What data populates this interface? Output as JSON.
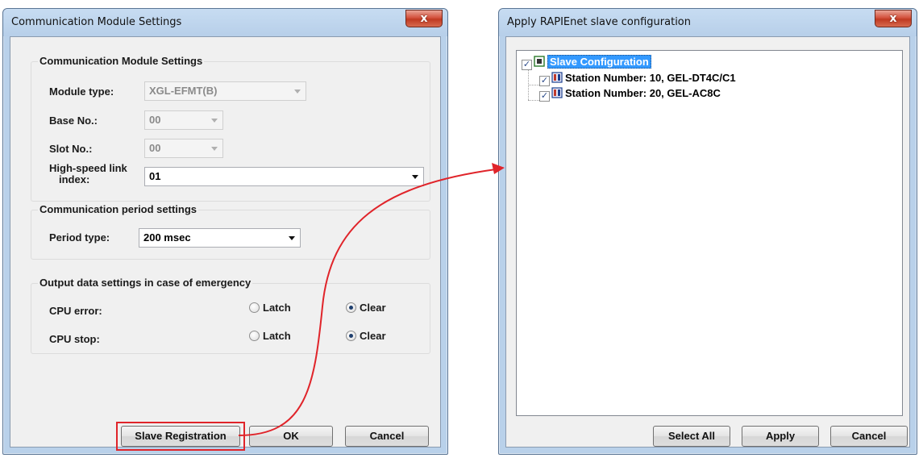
{
  "left_dialog": {
    "title": "Communication Module Settings",
    "close": "x",
    "module_group": {
      "title": "Communication Module Settings",
      "module_type_label": "Module type:",
      "module_type_value": "XGL-EFMT(B)",
      "base_label": "Base No.:",
      "base_value": "00",
      "slot_label": "Slot No.:",
      "slot_value": "00",
      "hs_link_label_1": "High-speed link",
      "hs_link_label_2": "index:",
      "hs_link_value": "01"
    },
    "period_group": {
      "title": "Communication period settings",
      "period_type_label": "Period type:",
      "period_type_value": "200 msec"
    },
    "emergency_group": {
      "title": "Output data settings in case of emergency",
      "cpu_error_label": "CPU error:",
      "cpu_stop_label": "CPU stop:",
      "latch_label": "Latch",
      "clear_label": "Clear",
      "cpu_error_selected": "Clear",
      "cpu_stop_selected": "Clear"
    },
    "buttons": {
      "slave_registration": "Slave Registration",
      "ok": "OK",
      "cancel": "Cancel"
    }
  },
  "right_dialog": {
    "title": "Apply RAPIEnet slave configuration",
    "close": "x",
    "tree": {
      "root": "Slave Configuration",
      "children": [
        "Station Number: 10, GEL-DT4C/C1",
        "Station Number: 20, GEL-AC8C"
      ]
    },
    "buttons": {
      "select_all": "Select All",
      "apply": "Apply",
      "cancel": "Cancel"
    }
  },
  "colors": {
    "annotation": "#e0242a",
    "selection": "#3399ff",
    "window_frame": "#b9d1ea"
  }
}
